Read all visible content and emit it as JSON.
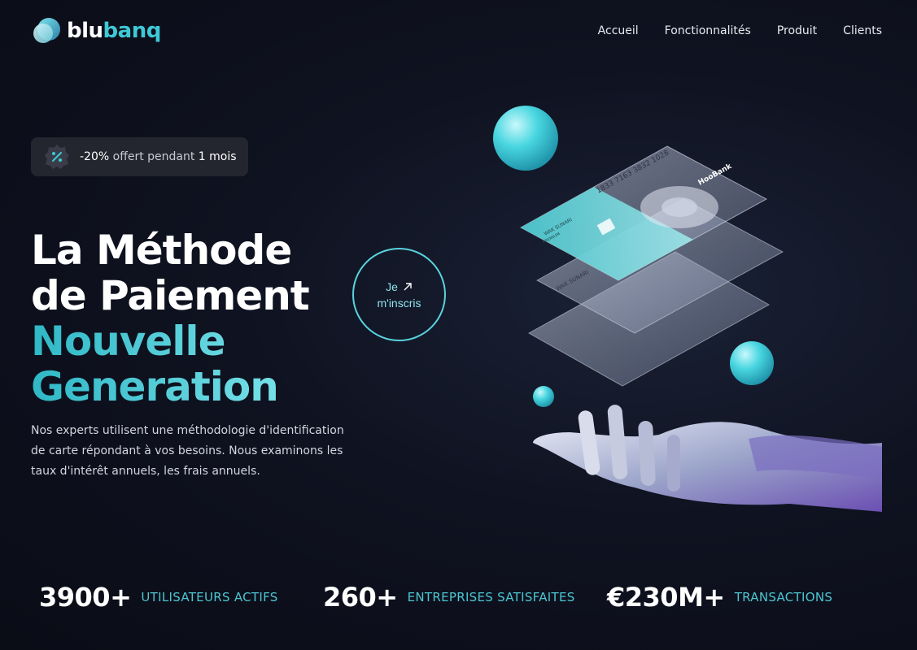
{
  "brand": {
    "part1": "blu",
    "part2": "banq",
    "icon": "logo-orb-icon"
  },
  "nav": {
    "items": [
      "Accueil",
      "Fonctionnalités",
      "Produit",
      "Clients"
    ]
  },
  "promo": {
    "icon": "percent-badge-icon",
    "discount": "-20%",
    "middle": " offert pendant ",
    "duration": "1 mois"
  },
  "hero": {
    "line1": "La Méthode",
    "line2": "de Paiement",
    "line3": "Nouvelle",
    "line4": "Generation",
    "description": "Nos experts utilisent une méthodologie d'identification de carte répondant à vos besoins. Nous examinons les taux d'intérêt annuels, les frais annuels."
  },
  "cta": {
    "line1": "Je",
    "line2": "m'inscris",
    "icon": "arrow-up-right-icon"
  },
  "cards": {
    "number": "1833 7163 3832 1028",
    "bank": "HooBank",
    "holder": "WAK SUNARI",
    "holder_sub": "PREMIUM"
  },
  "stats": [
    {
      "value": "3900+",
      "label": "UTILISATEURS ACTIFS"
    },
    {
      "value": "260+",
      "label": "ENTREPRISES SATISFAITES"
    },
    {
      "value": "€230M+",
      "label": "TRANSACTIONS"
    }
  ],
  "colors": {
    "accent": "#3ec9d6",
    "background": "#0f1220",
    "promo_bg": "#24262f"
  }
}
